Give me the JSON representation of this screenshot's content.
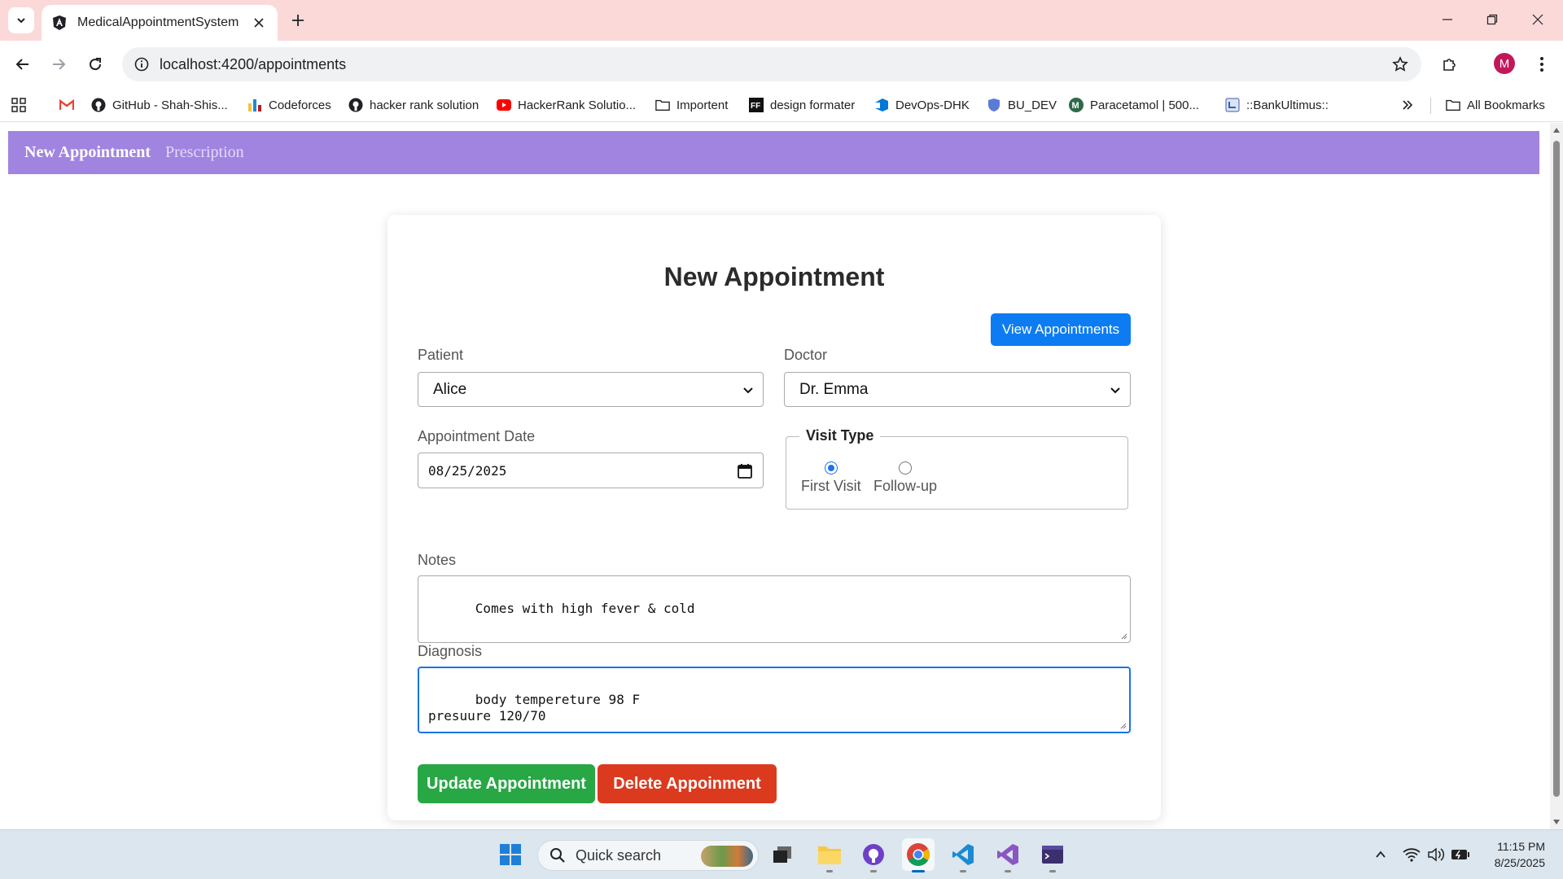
{
  "browser": {
    "tab_title": "MedicalAppointmentSystem",
    "url": "localhost:4200/appointments",
    "profile_initial": "M",
    "bookmarks": [
      {
        "label": ""
      },
      {
        "label": "GitHub - Shah-Shis..."
      },
      {
        "label": "Codeforces"
      },
      {
        "label": "hacker rank solution"
      },
      {
        "label": "HackerRank Solutio..."
      },
      {
        "label": "Importent"
      },
      {
        "label": "design formater"
      },
      {
        "label": "DevOps-DHK"
      },
      {
        "label": "BU_DEV"
      },
      {
        "label": "Paracetamol | 500..."
      },
      {
        "label": "::BankUltimus::"
      }
    ],
    "all_bookmarks": "All Bookmarks"
  },
  "nav": {
    "items": [
      "New Appointment",
      "Prescription"
    ],
    "active": "New Appointment"
  },
  "form": {
    "title": "New Appointment",
    "view_button": "View Appointments",
    "patient_label": "Patient",
    "patient_value": "Alice",
    "doctor_label": "Doctor",
    "doctor_value": "Dr. Emma",
    "date_label": "Appointment Date",
    "date_value": "08/25/2025",
    "visit_type_legend": "Visit Type",
    "visit_options": [
      "First Visit",
      "Follow-up"
    ],
    "visit_selected": "First Visit",
    "notes_label": "Notes",
    "notes_value": "Comes with high fever & cold",
    "diagnosis_label": "Diagnosis",
    "diagnosis_value": "body tempereture 98 F\npresuure 120/70",
    "update_button": "Update Appointment",
    "delete_button": "Delete Appoinment"
  },
  "taskbar": {
    "search_placeholder": "Quick search",
    "time": "11:15 PM",
    "date": "8/25/2025"
  },
  "colors": {
    "nav_bg": "#a084e0",
    "primary": "#0d7cf2",
    "success": "#28a745",
    "danger": "#dc3a1f",
    "tabbar_bg": "#fbd9d9"
  }
}
